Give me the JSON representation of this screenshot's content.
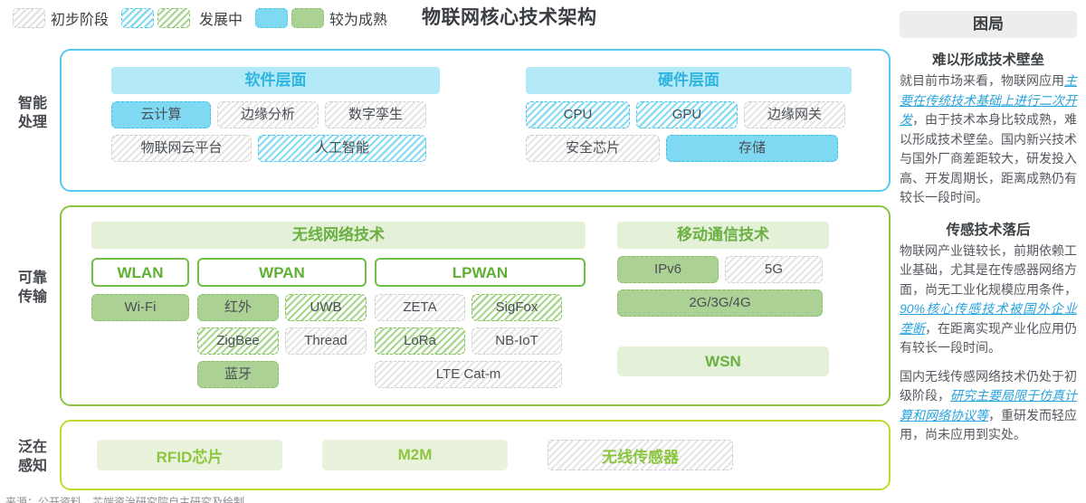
{
  "title": "物联网核心技术架构",
  "legend": {
    "items": [
      {
        "label": "初步阶段",
        "swatches": [
          "gray"
        ]
      },
      {
        "label": "发展中",
        "swatches": [
          "cyan-h",
          "green-h"
        ]
      },
      {
        "label": "较为成熟",
        "swatches": [
          "cyan-s",
          "green-s"
        ]
      }
    ],
    "colors": {
      "gray_hatch": "#e6e6e6",
      "cyan_hatch": "#86dcf2",
      "green_hatch": "#a9d68d",
      "cyan_solid": "#7fd9f2",
      "green_solid": "#acd194"
    }
  },
  "rows": [
    {
      "label": "智能\n处理",
      "label_line1": "智能",
      "label_line2": "处理",
      "accent": "#57c8ef",
      "panels": [
        {
          "header": "软件层面",
          "cells": [
            {
              "text": "云计算",
              "state": "cyans"
            },
            {
              "text": "边缘分析",
              "state": "gray"
            },
            {
              "text": "数字孪生",
              "state": "gray"
            },
            {
              "text": "物联网云平台",
              "state": "gray"
            },
            {
              "text": "人工智能",
              "state": "cyanh"
            }
          ]
        },
        {
          "header": "硬件层面",
          "cells": [
            {
              "text": "CPU",
              "state": "cyanh"
            },
            {
              "text": "GPU",
              "state": "cyanh"
            },
            {
              "text": "边缘网关",
              "state": "gray"
            },
            {
              "text": "安全芯片",
              "state": "gray"
            },
            {
              "text": "存储",
              "state": "cyans"
            }
          ]
        }
      ]
    },
    {
      "label_line1": "可靠",
      "label_line2": "传输",
      "accent": "#8cc63f",
      "wireless_header": "无线网络技术",
      "groups": [
        {
          "name": "WLAN",
          "cells": [
            {
              "text": "Wi-Fi",
              "state": "greens"
            }
          ]
        },
        {
          "name": "WPAN",
          "cells": [
            {
              "text": "红外",
              "state": "greens"
            },
            {
              "text": "UWB",
              "state": "greenh"
            },
            {
              "text": "ZigBee",
              "state": "greenh"
            },
            {
              "text": "Thread",
              "state": "gray"
            },
            {
              "text": "蓝牙",
              "state": "greens"
            }
          ]
        },
        {
          "name": "LPWAN",
          "cells": [
            {
              "text": "ZETA",
              "state": "gray"
            },
            {
              "text": "SigFox",
              "state": "greenh"
            },
            {
              "text": "LoRa",
              "state": "greenh"
            },
            {
              "text": "NB-IoT",
              "state": "gray"
            },
            {
              "text": "LTE Cat-m",
              "state": "gray"
            }
          ]
        }
      ],
      "mobile_header": "移动通信技术",
      "mobile_cells": [
        {
          "text": "IPv6",
          "state": "greens"
        },
        {
          "text": "5G",
          "state": "gray"
        },
        {
          "text": "2G/3G/4G",
          "state": "greens"
        }
      ],
      "wsn_header": "WSN"
    },
    {
      "label_line1": "泛在",
      "label_line2": "感知",
      "accent": "#c5d92d",
      "cells": [
        {
          "text": "RFID芯片",
          "state": "lite"
        },
        {
          "text": "M2M",
          "state": "lite"
        },
        {
          "text": "无线传感器",
          "state": "hatch"
        }
      ]
    }
  ],
  "sidebar": {
    "header": "困局",
    "sections": [
      {
        "title": "难以形成技术壁垒",
        "paragraphs": [
          {
            "runs": [
              {
                "t": "就目前市场来看，物联网应用",
                "hl": false
              },
              {
                "t": "主要在传统技术基础上进行二次开发",
                "hl": true
              },
              {
                "t": "，由于技术本身比较成熟，难以形成技术壁垒。国内新兴技术与国外厂商差距较大，研发投入高、开发周期长，距离成熟仍有较长一段时间。",
                "hl": false
              }
            ]
          }
        ]
      },
      {
        "title": "传感技术落后",
        "paragraphs": [
          {
            "runs": [
              {
                "t": "物联网产业链较长，前期依赖工业基础，尤其是在传感器网络方面，尚无工业化规模应用条件，",
                "hl": false
              },
              {
                "t": "90%核心传感技术被国外企业垄断",
                "hl": true
              },
              {
                "t": "，在距离实现产业化应用仍有较长一段时间。",
                "hl": false
              }
            ]
          },
          {
            "runs": [
              {
                "t": "国内无线传感网络技术仍处于初级阶段，",
                "hl": false
              },
              {
                "t": "研究主要局限于仿真计算和网络协议等",
                "hl": true
              },
              {
                "t": "，重研发而轻应用，尚未应用到实处。",
                "hl": false
              }
            ]
          }
        ]
      }
    ]
  },
  "footer": "来源：公开资料、芯端资治研究院自主研究及绘制"
}
